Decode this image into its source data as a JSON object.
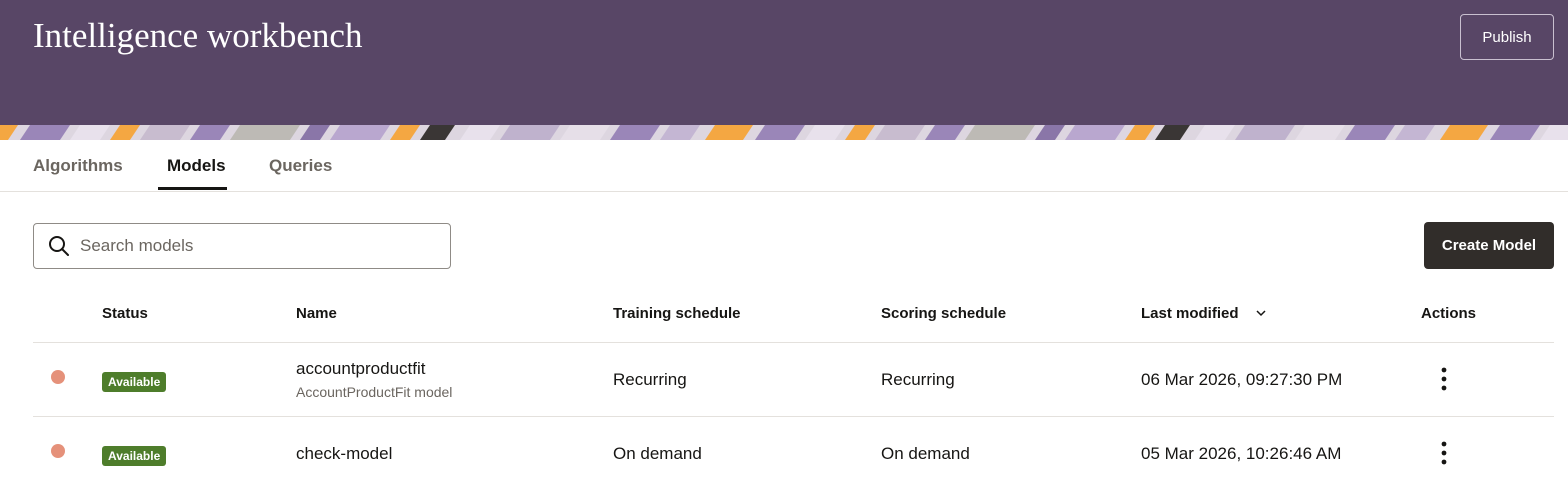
{
  "header": {
    "title": "Intelligence workbench",
    "publish_label": "Publish",
    "background_color": "#584666"
  },
  "tabs": [
    {
      "label": "Algorithms",
      "active": false
    },
    {
      "label": "Models",
      "active": true
    },
    {
      "label": "Queries",
      "active": false
    }
  ],
  "toolbar": {
    "search_placeholder": "Search models",
    "search_value": "",
    "create_label": "Create Model"
  },
  "table": {
    "columns": [
      "Status",
      "Name",
      "Training schedule",
      "Scoring schedule",
      "Last modified",
      "Actions"
    ],
    "sort_column": "Last modified",
    "sort_direction": "descending",
    "rows": [
      {
        "status": "Available",
        "name": "accountproductfit",
        "description": "AccountProductFit model",
        "training_schedule": "Recurring",
        "scoring_schedule": "Recurring",
        "last_modified": "06 Mar 2026, 09:27:30 PM"
      },
      {
        "status": "Available",
        "name": "check-model",
        "description": "",
        "training_schedule": "On demand",
        "scoring_schedule": "On demand",
        "last_modified": "05 Mar 2026, 10:26:46 AM"
      }
    ]
  },
  "colors": {
    "status_available": "#4e7d2b",
    "status_dot": "#e5917a",
    "primary_button": "#312d2a"
  },
  "icons": [
    "search-icon",
    "chevron-down-icon",
    "kebab-menu-icon"
  ]
}
